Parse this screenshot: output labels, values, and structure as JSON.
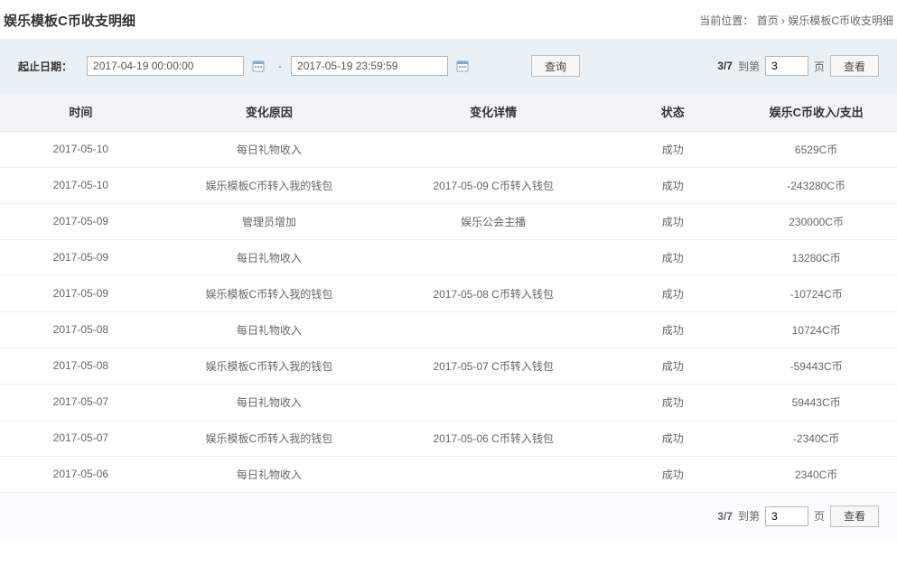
{
  "header": {
    "title": "娱乐模板C币收支明细",
    "breadcrumb_label": "当前位置：",
    "breadcrumb_home": "首页",
    "breadcrumb_sep": " › ",
    "breadcrumb_current": "娱乐模板C币收支明细"
  },
  "filter": {
    "label": "起止日期：",
    "start": "2017-04-19 00:00:00",
    "end": "2017-05-19 23:59:59",
    "dash": "-",
    "query": "查询"
  },
  "pager": {
    "position": "3/7",
    "to_label": "到第",
    "page_value": "3",
    "page_unit": "页",
    "view": "查看"
  },
  "table": {
    "headers": {
      "time": "时间",
      "reason": "变化原因",
      "detail": "变化详情",
      "status": "状态",
      "amount": "娱乐C币收入/支出"
    },
    "rows": [
      {
        "time": "2017-05-10",
        "reason": "每日礼物收入",
        "detail": "",
        "status": "成功",
        "amount": "6529C币"
      },
      {
        "time": "2017-05-10",
        "reason": "娱乐模板C币转入我的钱包",
        "detail": "2017-05-09 C币转入钱包",
        "status": "成功",
        "amount": "-243280C币"
      },
      {
        "time": "2017-05-09",
        "reason": "管理员增加",
        "detail": "娱乐公会主播",
        "status": "成功",
        "amount": "230000C币"
      },
      {
        "time": "2017-05-09",
        "reason": "每日礼物收入",
        "detail": "",
        "status": "成功",
        "amount": "13280C币"
      },
      {
        "time": "2017-05-09",
        "reason": "娱乐模板C币转入我的钱包",
        "detail": "2017-05-08 C币转入钱包",
        "status": "成功",
        "amount": "-10724C币"
      },
      {
        "time": "2017-05-08",
        "reason": "每日礼物收入",
        "detail": "",
        "status": "成功",
        "amount": "10724C币"
      },
      {
        "time": "2017-05-08",
        "reason": "娱乐模板C币转入我的钱包",
        "detail": "2017-05-07 C币转入钱包",
        "status": "成功",
        "amount": "-59443C币"
      },
      {
        "time": "2017-05-07",
        "reason": "每日礼物收入",
        "detail": "",
        "status": "成功",
        "amount": "59443C币"
      },
      {
        "time": "2017-05-07",
        "reason": "娱乐模板C币转入我的钱包",
        "detail": "2017-05-06 C币转入钱包",
        "status": "成功",
        "amount": "-2340C币"
      },
      {
        "time": "2017-05-06",
        "reason": "每日礼物收入",
        "detail": "",
        "status": "成功",
        "amount": "2340C币"
      }
    ]
  }
}
